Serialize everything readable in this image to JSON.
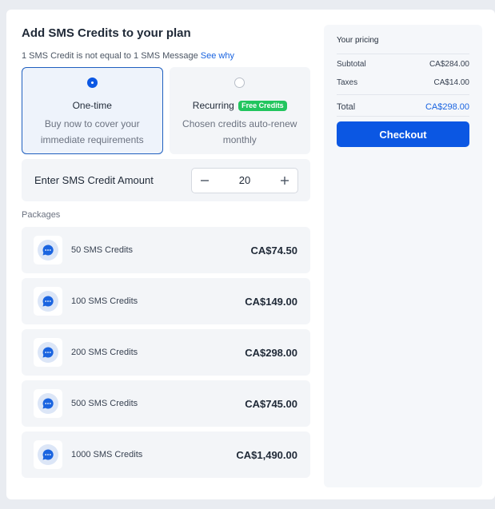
{
  "header": {
    "title": "Add SMS Credits to your plan",
    "subtitle": "1 SMS Credit is not equal to 1 SMS Message",
    "see_why": "See why"
  },
  "options": [
    {
      "title": "One-time",
      "description": "Buy now to cover your immediate requirements",
      "selected": true
    },
    {
      "title": "Recurring",
      "badge": "Free Credits",
      "description": "Chosen credits auto-renew monthly",
      "selected": false
    }
  ],
  "amount": {
    "label": "Enter SMS Credit Amount",
    "value": "20",
    "decrement_icon": "minus-icon",
    "increment_icon": "plus-icon"
  },
  "packages": {
    "label": "Packages",
    "items": [
      {
        "name": "50 SMS Credits",
        "price": "CA$74.50"
      },
      {
        "name": "100 SMS Credits",
        "price": "CA$149.00"
      },
      {
        "name": "200 SMS Credits",
        "price": "CA$298.00"
      },
      {
        "name": "500 SMS Credits",
        "price": "CA$745.00"
      },
      {
        "name": "1000 SMS Credits",
        "price": "CA$1,490.00"
      }
    ],
    "icon": "chat-bubble-icon"
  },
  "pricing": {
    "title": "Your pricing",
    "subtotal_label": "Subtotal",
    "subtotal_value": "CA$284.00",
    "taxes_label": "Taxes",
    "taxes_value": "CA$14.00",
    "total_label": "Total",
    "total_value": "CA$298.00",
    "checkout_label": "Checkout"
  },
  "colors": {
    "accent": "#0b57e3",
    "link": "#1a64e0",
    "badge_green": "#22c55e",
    "panel_bg": "#f3f5f8"
  }
}
